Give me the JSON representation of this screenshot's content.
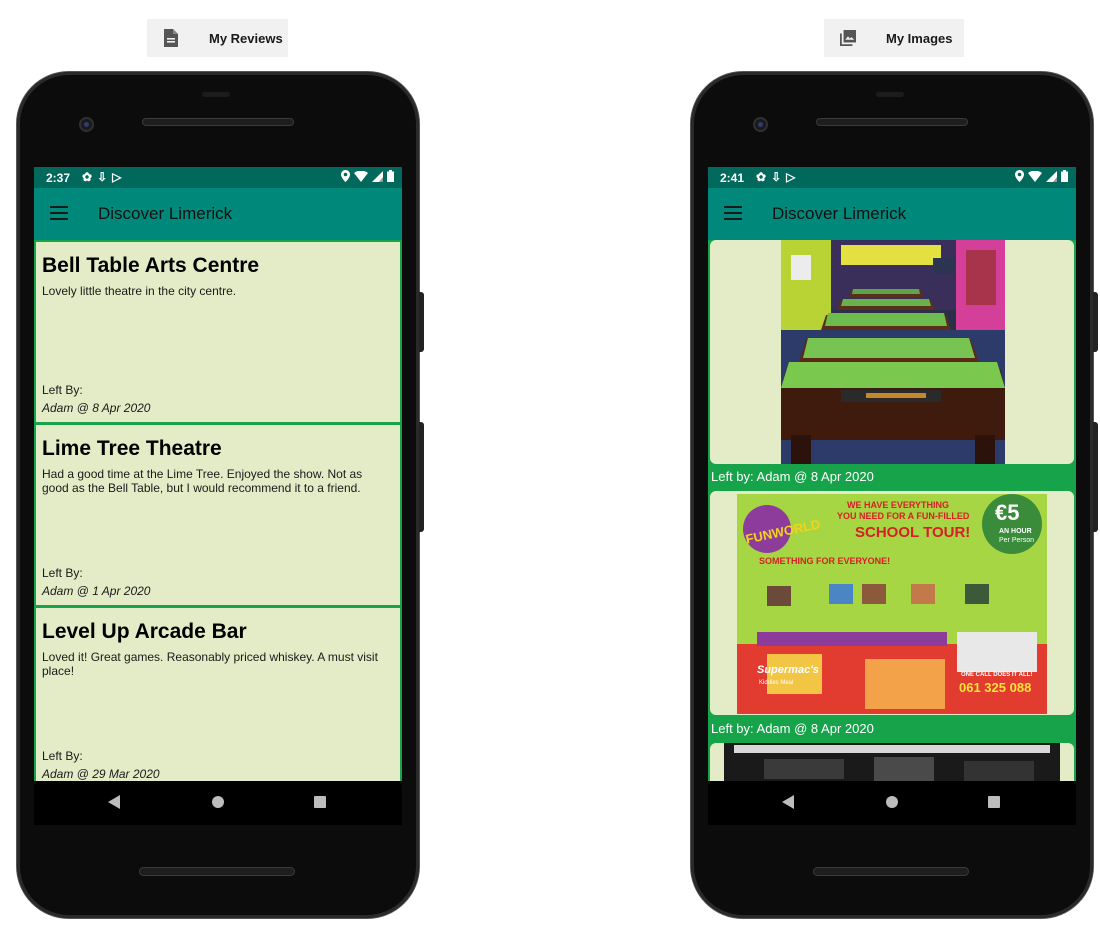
{
  "left_caption": {
    "icon": "document-icon",
    "label": "My Reviews"
  },
  "right_caption": {
    "icon": "image-gallery-icon",
    "label": "My Images"
  },
  "colors": {
    "status_bar": "#00695c",
    "app_bar": "#00897b",
    "card_bg": "#e3ecc7",
    "list_bg": "#16a34a"
  },
  "left_phone": {
    "status": {
      "time": "2:37"
    },
    "app_title": "Discover Limerick",
    "reviews": [
      {
        "title": "Bell Table Arts Centre",
        "body": "Lovely little theatre in the city centre.",
        "left_by_label": "Left By:",
        "author": "Adam @ 8 Apr 2020"
      },
      {
        "title": "Lime Tree Theatre",
        "body": "Had a good time at the Lime Tree. Enjoyed the show. Not as good as the Bell Table, but I would recommend it to a friend.",
        "left_by_label": "Left By:",
        "author": "Adam @ 1 Apr 2020"
      },
      {
        "title": "Level Up Arcade Bar",
        "body": "Loved it! Great games. Reasonably priced whiskey. A must visit place!",
        "left_by_label": "Left By:",
        "author": "Adam @ 29 Mar 2020"
      }
    ]
  },
  "right_phone": {
    "status": {
      "time": "2:41"
    },
    "app_title": "Discover Limerick",
    "images": [
      {
        "description": "pool-tables-photo",
        "caption": "Left by: Adam @ 8 Apr 2020"
      },
      {
        "description": "funworld-flyer",
        "caption": "Left by: Adam @ 8 Apr 2020",
        "flyer": {
          "brand": "FUNWORLD",
          "headline_1": "WE HAVE EVERYTHING",
          "headline_2": "YOU NEED FOR A FUN-FILLED",
          "headline_3": "SCHOOL TOUR!",
          "price": "€5",
          "price_note_1": "AN HOUR",
          "price_note_2": "Per Person",
          "tagline": "SOMETHING FOR EVERYONE!",
          "sponsor": "Supermac's",
          "sponsor_note": "Kiddies Meal",
          "phone_label": "ONE CALL DOES IT ALL!",
          "phone": "061 325 088"
        }
      },
      {
        "description": "arcade-photo"
      }
    ]
  }
}
